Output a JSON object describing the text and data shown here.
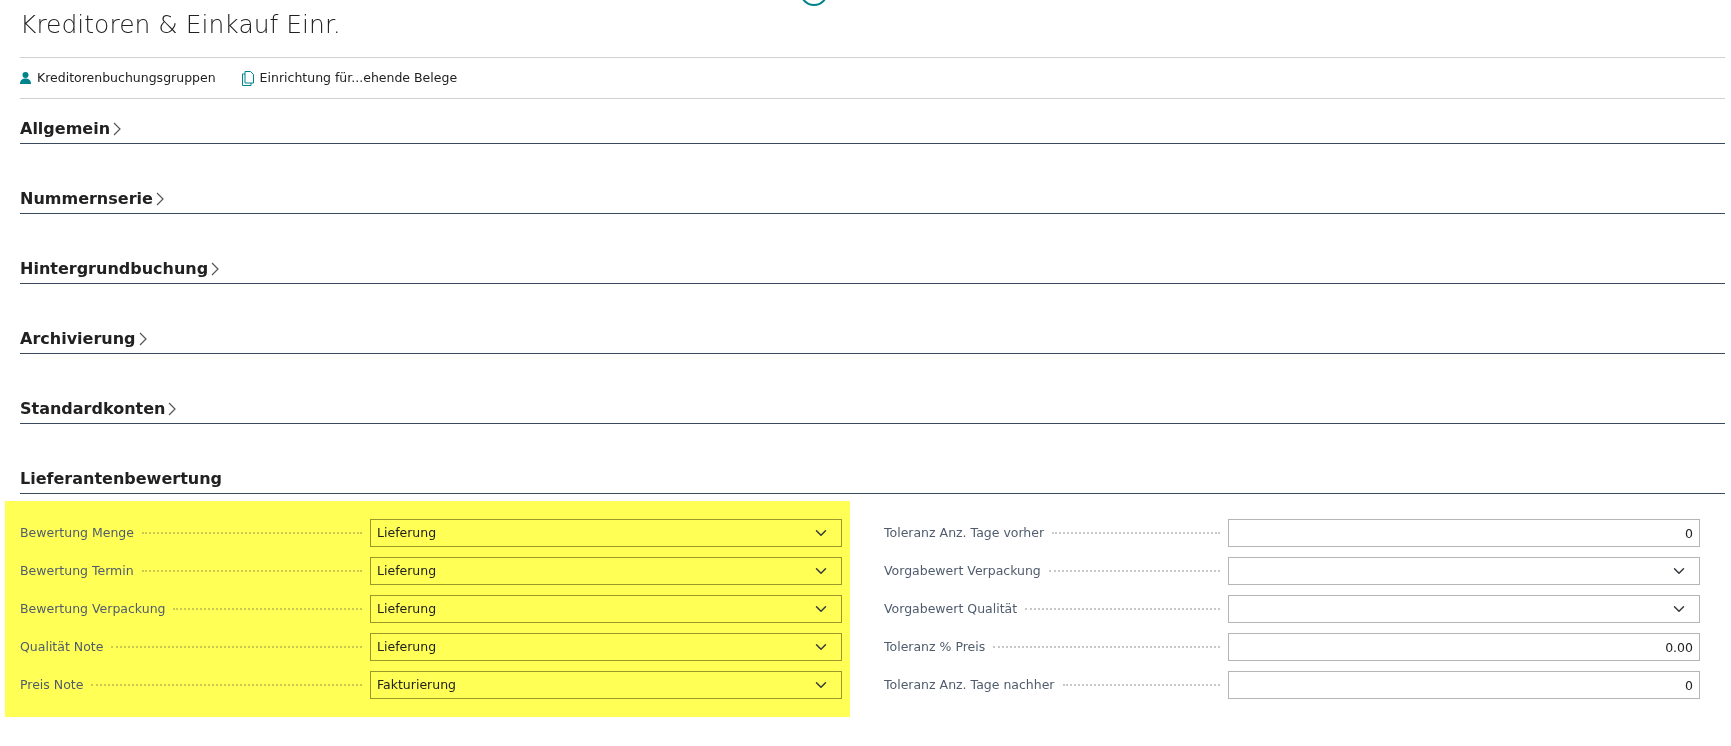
{
  "page": {
    "title": "Kreditoren & Einkauf Einr."
  },
  "actions": [
    {
      "kind": "person",
      "label": "Kreditorenbuchungsgruppen"
    },
    {
      "kind": "document",
      "label": "Einrichtung für...ehende Belege"
    }
  ],
  "sections": [
    {
      "title": "Allgemein",
      "expanded": false
    },
    {
      "title": "Nummernserie",
      "expanded": false
    },
    {
      "title": "Hintergrundbuchung",
      "expanded": false
    },
    {
      "title": "Archivierung",
      "expanded": false
    },
    {
      "title": "Standardkonten",
      "expanded": false
    },
    {
      "title": "Lieferantenbewertung",
      "expanded": true,
      "columns": [
        {
          "highlighted": true,
          "fields": [
            {
              "label": "Bewertung Menge",
              "kind": "select",
              "value": "Lieferung"
            },
            {
              "label": "Bewertung Termin",
              "kind": "select",
              "value": "Lieferung"
            },
            {
              "label": "Bewertung Verpackung",
              "kind": "select",
              "value": "Lieferung"
            },
            {
              "label": "Qualität Note",
              "kind": "select",
              "value": "Lieferung"
            },
            {
              "label": "Preis Note",
              "kind": "select",
              "value": "Fakturierung"
            }
          ]
        },
        {
          "highlighted": false,
          "fields": [
            {
              "label": "Toleranz Anz. Tage vorher",
              "kind": "number",
              "value": "0"
            },
            {
              "label": "Vorgabewert Verpackung",
              "kind": "select"
            },
            {
              "label": "Vorgabewert Qualität",
              "kind": "select"
            },
            {
              "label": "Toleranz % Preis",
              "kind": "number",
              "value": "0.00"
            },
            {
              "label": "Toleranz Anz. Tage nachher",
              "kind": "number",
              "value": "0"
            }
          ]
        }
      ]
    }
  ]
}
